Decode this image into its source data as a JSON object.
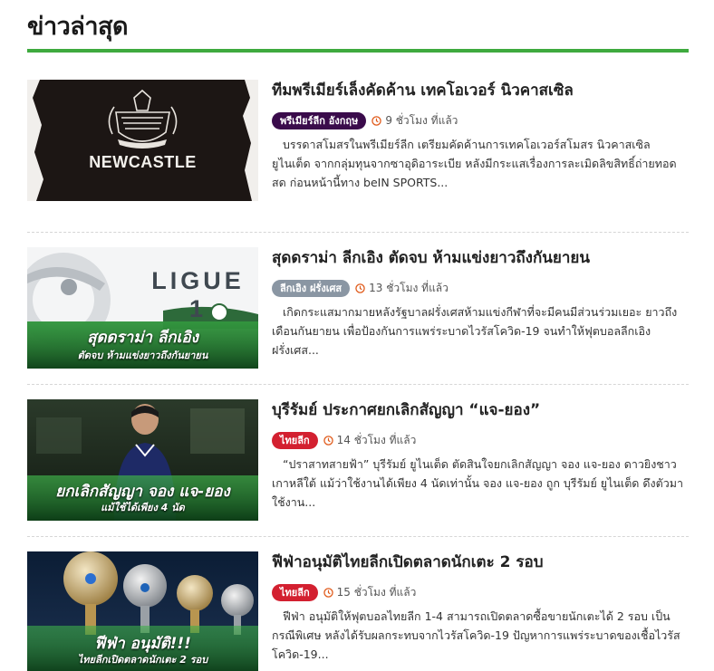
{
  "section": {
    "title": "ข่าวล่าสุด"
  },
  "colors": {
    "accent_green": "#3eaa3e",
    "premier_league": "#3a0b4b",
    "ligue1": "#8a96a3",
    "thai_league": "#d32030",
    "clock": "#e05a1a"
  },
  "news": [
    {
      "headline": "ทีมพรีเมียร์เล็งคัดค้าน เทคโอเวอร์ นิวคาสเซิล",
      "category": "พรีเมียร์ลีก อังกฤษ",
      "time": "9 ชั่วโมง ที่แล้ว",
      "excerpt": "บรรดาสโมสรในพรีเมียร์ลีก เตรียมคัดค้านการเทคโอเวอร์สโมสร นิวคาสเซิล ยูไนเต็ด จากกลุ่มทุนจากซาอุดิอาระเบีย หลังมีกระแสเรื่องการละเมิดลิขสิทธิ์ถ่ายทอดสด ก่อนหน้านี้ทาง beIN SPORTS...",
      "thumb": {
        "logo_text": "NEWCASTLE UNITED",
        "big_text": "NEWCASTLE",
        "icon": "newcastle-crest-icon"
      }
    },
    {
      "headline": "สุดดราม่า ลีกเอิง ตัดจบ ห้ามแข่งยาวถึงกันยายน",
      "category": "ลีกเอิง ฝรั่งเศส",
      "time": "13 ชั่วโมง ที่แล้ว",
      "excerpt": "เกิดกระแสมากมายหลังรัฐบาลฝรั่งเศสห้ามแข่งกีฬาที่จะมีคนมีส่วนร่วมเยอะ ยาวถึงเดือนกันยายน เพื่อป้องกันการแพร่ระบาดไวรัสโควิด-19 จนทำให้ฟุตบอลลีกเอิง ฝรั่งเศส...",
      "thumb": {
        "logo_text": "LIGUE 1",
        "caption1": "สุดดราม่า ลีกเอิง",
        "caption2": "ตัดจบ ห้ามแข่งยาวถึงกันยายน",
        "icon": "ligue1-logo-icon"
      }
    },
    {
      "headline": "บุรีรัมย์ ประกาศยกเลิกสัญญา “แจ-ยอง”",
      "category": "ไทยลีก",
      "time": "14 ชั่วโมง ที่แล้ว",
      "excerpt": "“ปราสาทสายฟ้า” บุรีรัมย์ ยูไนเต็ด ตัดสินใจยกเลิกสัญญา จอง แจ-ยอง ดาวยิงชาวเกาหลีใต้ แม้ว่าใช้งานได้เพียง 4 นัดเท่านั้น จอง แจ-ยอง ถูก บุรีรัมย์ ยูไนเต็ด ดึงตัวมาใช้งาน...",
      "thumb": {
        "caption1": "ยกเลิกสัญญา จอง แจ-ยอง",
        "caption2": "แม้ใช้ได้เพียง 4 นัด",
        "icon": "player-photo-icon"
      }
    },
    {
      "headline": "ฟีฟ่าอนุมัติไทยลีกเปิดตลาดนักเตะ 2 รอบ",
      "category": "ไทยลีก",
      "time": "15 ชั่วโมง ที่แล้ว",
      "excerpt": "ฟีฟ่า อนุมัติให้ฟุตบอลไทยลีก 1-4 สามารถเปิดตลาดซื้อขายนักเตะได้ 2 รอบ เป็นกรณีพิเศษ หลังได้รับผลกระทบจากไวรัสโควิด-19 ปัญหาการแพร่ระบาดของเชื้อไวรัสโควิด-19...",
      "thumb": {
        "caption1": "ฟีฟ่า อนุมัติ!!!",
        "caption2": "ไทยลีกเปิดตลาดนักเตะ 2 รอบ",
        "icon": "trophies-icon"
      }
    }
  ]
}
